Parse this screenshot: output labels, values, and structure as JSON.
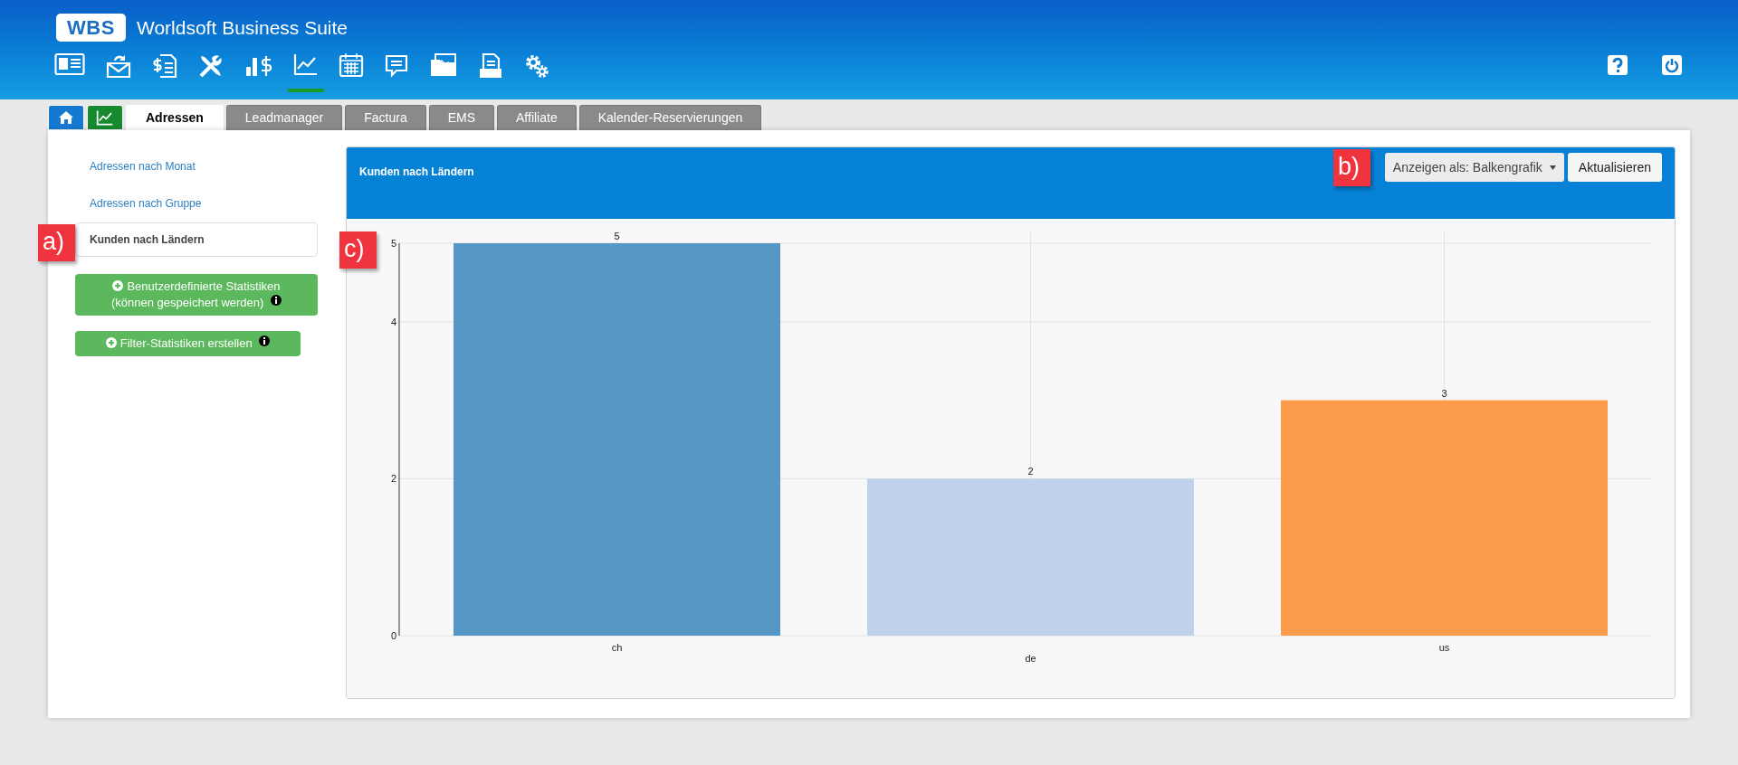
{
  "header": {
    "logo": "WBS",
    "title": "Worldsoft Business Suite"
  },
  "nav_icons": [
    {
      "kind": "contact",
      "selected": false
    },
    {
      "kind": "mail",
      "selected": false
    },
    {
      "kind": "invoice",
      "selected": false
    },
    {
      "kind": "tools",
      "selected": false
    },
    {
      "kind": "sales",
      "selected": false
    },
    {
      "kind": "statistics",
      "selected": true
    },
    {
      "kind": "calendar",
      "selected": false
    },
    {
      "kind": "chat",
      "selected": false
    },
    {
      "kind": "gallery",
      "selected": false
    },
    {
      "kind": "print",
      "selected": false
    },
    {
      "kind": "settings",
      "selected": false
    }
  ],
  "header_actions": [
    {
      "kind": "help"
    },
    {
      "kind": "power"
    }
  ],
  "tabs": [
    {
      "kind": "home",
      "selected": false
    },
    {
      "kind": "statistics",
      "selected": false
    },
    {
      "kind": "text",
      "label": "Adressen",
      "selected": true
    },
    {
      "kind": "text",
      "label": "Leadmanager",
      "selected": false
    },
    {
      "kind": "text",
      "label": "Factura",
      "selected": false
    },
    {
      "kind": "text",
      "label": "EMS",
      "selected": false
    },
    {
      "kind": "text",
      "label": "Affiliate",
      "selected": false
    },
    {
      "kind": "text",
      "label": "Kalender-Reservierungen",
      "selected": false
    }
  ],
  "sidebar": {
    "items": [
      {
        "label": "Adressen nach Monat",
        "selected": false
      },
      {
        "label": "Adressen nach Gruppe",
        "selected": false
      },
      {
        "label": "Kunden nach Ländern",
        "selected": true
      }
    ],
    "buttons": [
      {
        "label": "Benutzerdefinierte Statistiken (können gespeichert werden)"
      },
      {
        "label": "Filter-Statistiken erstellen"
      }
    ]
  },
  "panel": {
    "title": "Kunden nach Ländern",
    "view_select": "Anzeigen als: Balkengrafik",
    "refresh_button": "Aktualisieren",
    "chart_data": {
      "type": "bar",
      "categories": [
        "ch",
        "de",
        "us"
      ],
      "values": [
        5,
        2,
        3
      ],
      "colors": [
        "#5597c4",
        "#c0d2eb",
        "#fc9b4a"
      ],
      "ylim": [
        0,
        5
      ],
      "yticks": [
        0,
        2,
        4,
        5
      ],
      "data_labels": true,
      "grid": true
    }
  },
  "callouts": [
    {
      "kind": "sidebar",
      "label": "a)"
    },
    {
      "kind": "toolbar",
      "label": "b)"
    },
    {
      "kind": "chart",
      "label": "c)"
    }
  ]
}
